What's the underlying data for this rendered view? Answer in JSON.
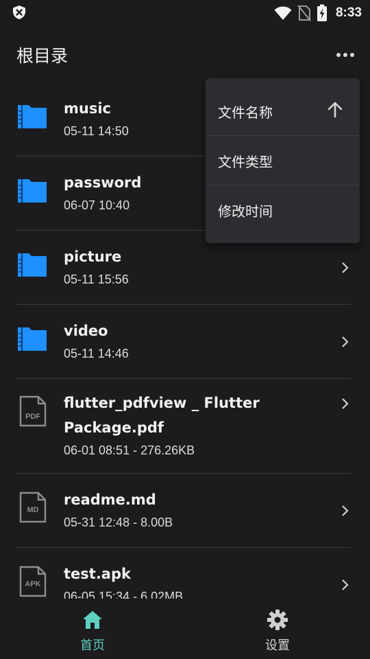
{
  "status_bar": {
    "time": "8:33",
    "icons": [
      "shield-x-icon",
      "wifi-icon",
      "no-sim-icon",
      "battery-charging-icon"
    ]
  },
  "app_bar": {
    "title": "根目录",
    "more_icon": "more-horizontal-icon"
  },
  "files": [
    {
      "name": "music",
      "meta": "05-11 14:50",
      "type": "folder"
    },
    {
      "name": "password",
      "meta": "06-07 10:40",
      "type": "folder"
    },
    {
      "name": "picture",
      "meta": "05-11 15:56",
      "type": "folder"
    },
    {
      "name": "video",
      "meta": "05-11 14:46",
      "type": "folder"
    },
    {
      "name": "flutter_pdfview _ Flutter Package.pdf",
      "meta": "06-01 08:51 - 276.26KB",
      "type": "file",
      "badge": "PDF"
    },
    {
      "name": "readme.md",
      "meta": "05-31 12:48 - 8.00B",
      "type": "file",
      "badge": "MD"
    },
    {
      "name": "test.apk",
      "meta": "06-05 15:34 - 6.02MB",
      "type": "file",
      "badge": "APK"
    }
  ],
  "sort_menu": {
    "items": [
      {
        "label": "文件名称",
        "arrow": "arrow-up-icon"
      },
      {
        "label": "文件类型"
      },
      {
        "label": "修改时间"
      }
    ]
  },
  "bottom_nav": {
    "items": [
      {
        "label": "首页",
        "icon": "home-icon",
        "active": true
      },
      {
        "label": "设置",
        "icon": "gear-icon",
        "active": false
      }
    ]
  },
  "colors": {
    "background": "#1c1c1e",
    "folder_blue": "#1e90ff",
    "accent_teal": "#5fd1c1",
    "menu_bg": "#2b2d30",
    "icon_gray": "#8e8e8e"
  }
}
